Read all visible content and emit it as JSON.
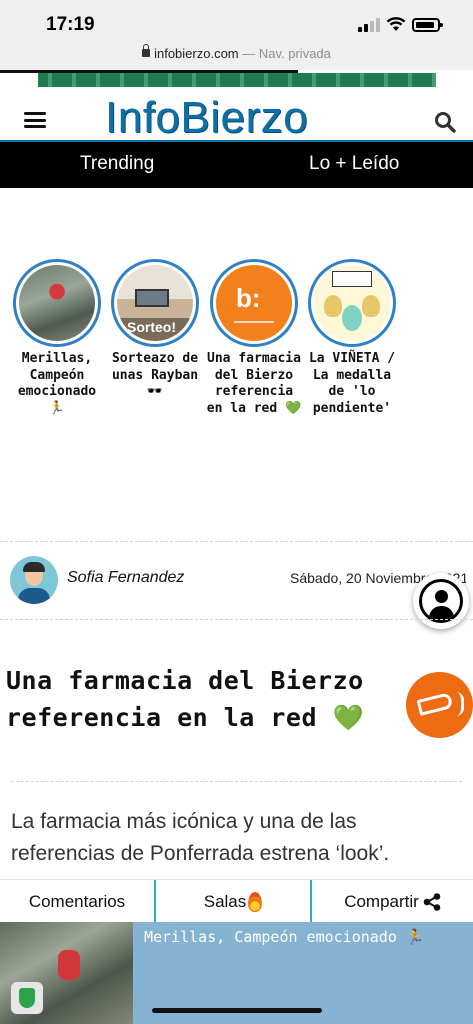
{
  "status_bar": {
    "time": "17:19"
  },
  "browser": {
    "url": "infobierzo.com",
    "mode": " — Nav. privada"
  },
  "header": {
    "logo": "InfoBierzo"
  },
  "nav": {
    "tabs": [
      "Trending",
      "Lo + Leído"
    ]
  },
  "stories": [
    {
      "label": "Merillas, Campeón emocionado 🏃"
    },
    {
      "label": "Sorteazo de unas Rayban 🕶️",
      "thumb_text": "Sorteo!"
    },
    {
      "label": "Una farmacia del Bierzo referencia en la red 💚",
      "thumb_text": "b:"
    },
    {
      "label": "La VIÑETA / La medalla de 'lo pendiente'"
    }
  ],
  "post": {
    "author": "Sofia Fernandez",
    "date": "Sábado, 20 Noviembre 2021",
    "title": "Una farmacia del Bierzo referencia en la red 💚",
    "lead": "La farmacia más icónica y una de las referencias de Ponferrada estrena ‘look’."
  },
  "action_bar": {
    "comments": "Comentarios",
    "rooms": "Salas",
    "share": "Compartir"
  },
  "video_strip": {
    "title": "Merillas, Campeón emocionado 🏃"
  },
  "colors": {
    "brand_blue": "#0d6fa6",
    "accent_orange": "#ef6b12",
    "divider_teal": "#27b3c2",
    "story_ring": "#2f80c7"
  }
}
